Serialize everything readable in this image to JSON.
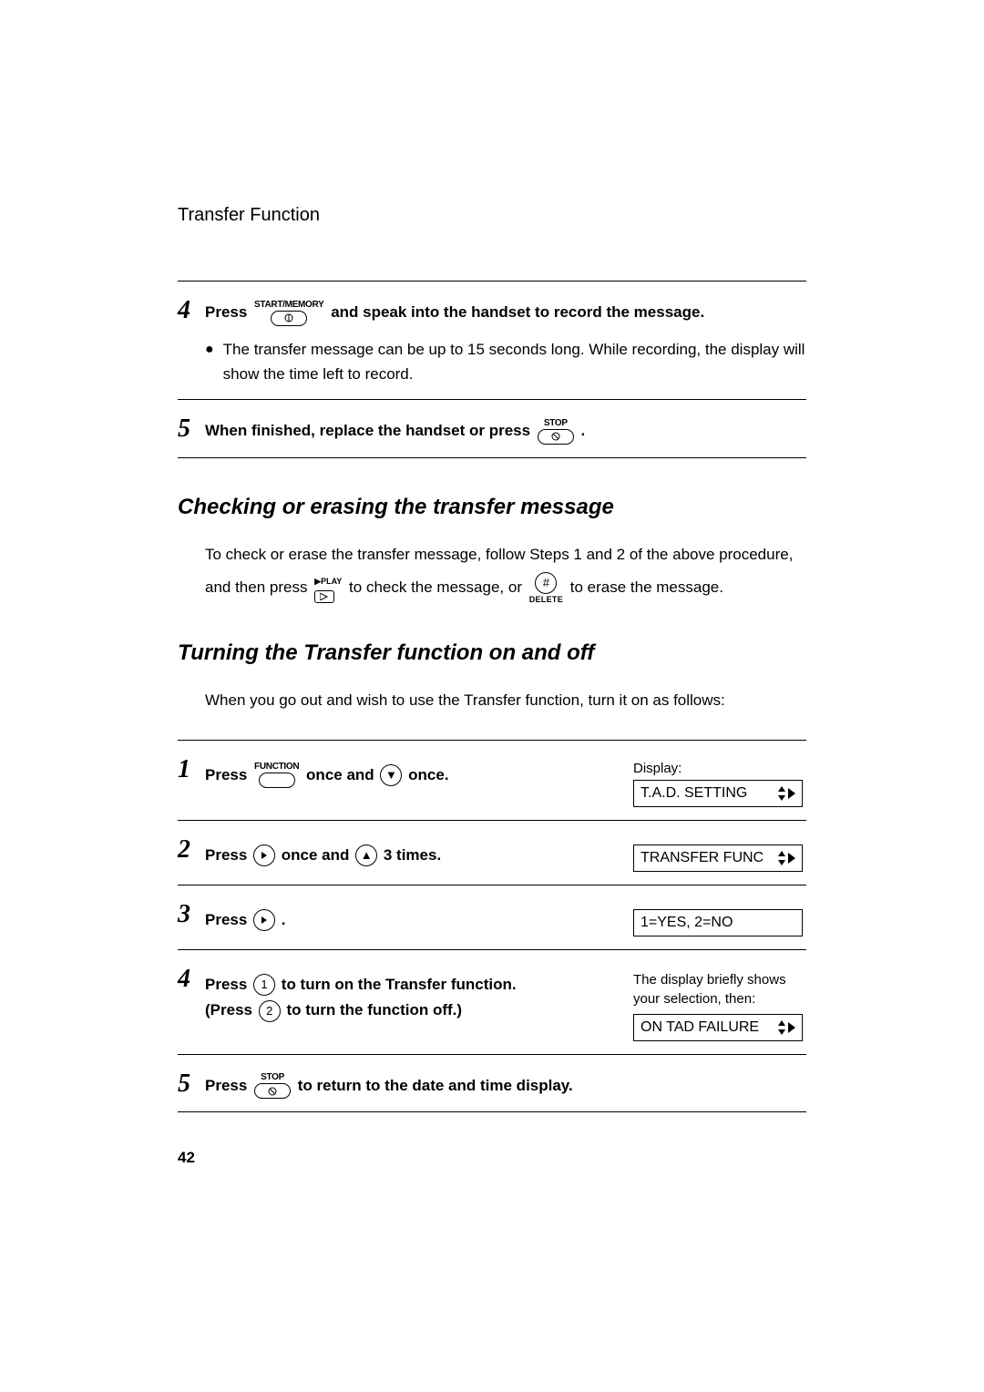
{
  "header": "Transfer Function",
  "page_number": "42",
  "buttons": {
    "start_memory": "START/MEMORY",
    "stop": "STOP",
    "function": "FUNCTION",
    "play": "PLAY",
    "delete": "DELETE"
  },
  "top_steps": {
    "s4": {
      "num": "4",
      "pre": "Press ",
      "post": " and speak into the handset to record the message.",
      "bullet": "The transfer message can be up to 15 seconds long. While recording, the display will show the time left to record."
    },
    "s5": {
      "num": "5",
      "pre": "When finished, replace the handset or press ",
      "post": " ."
    }
  },
  "sec1": {
    "heading": "Checking or erasing the transfer message",
    "t1": "To check or erase the transfer message, follow Steps 1 and 2 of the above procedure, and then press ",
    "t2": " to check the message, or ",
    "t3": " to erase the message."
  },
  "sec2": {
    "heading": "Turning the Transfer function on and off",
    "intro": "When you go out and wish to use the Transfer function, turn it on as follows:"
  },
  "steps2": {
    "s1": {
      "num": "1",
      "a": "Press ",
      "b": " once and ",
      "c": " once.",
      "display_label": "Display:",
      "display": "T.A.D. SETTING"
    },
    "s2": {
      "num": "2",
      "a": "Press ",
      "b": " once and ",
      "c": " 3 times.",
      "display": "TRANSFER FUNC"
    },
    "s3": {
      "num": "3",
      "a": "Press ",
      "b": " .",
      "display": "1=YES, 2=NO"
    },
    "s4": {
      "num": "4",
      "a": "Press ",
      "b": " to turn on the Transfer function.",
      "c": "(Press ",
      "d": " to turn the function off.)",
      "note": "The display briefly shows your selection, then:",
      "display": "ON TAD FAILURE"
    },
    "s5": {
      "num": "5",
      "a": "Press ",
      "b": " to return to the date and time display."
    }
  },
  "keys": {
    "down": "▼",
    "up": "▲",
    "one": "1",
    "two": "2",
    "hash": "#"
  }
}
